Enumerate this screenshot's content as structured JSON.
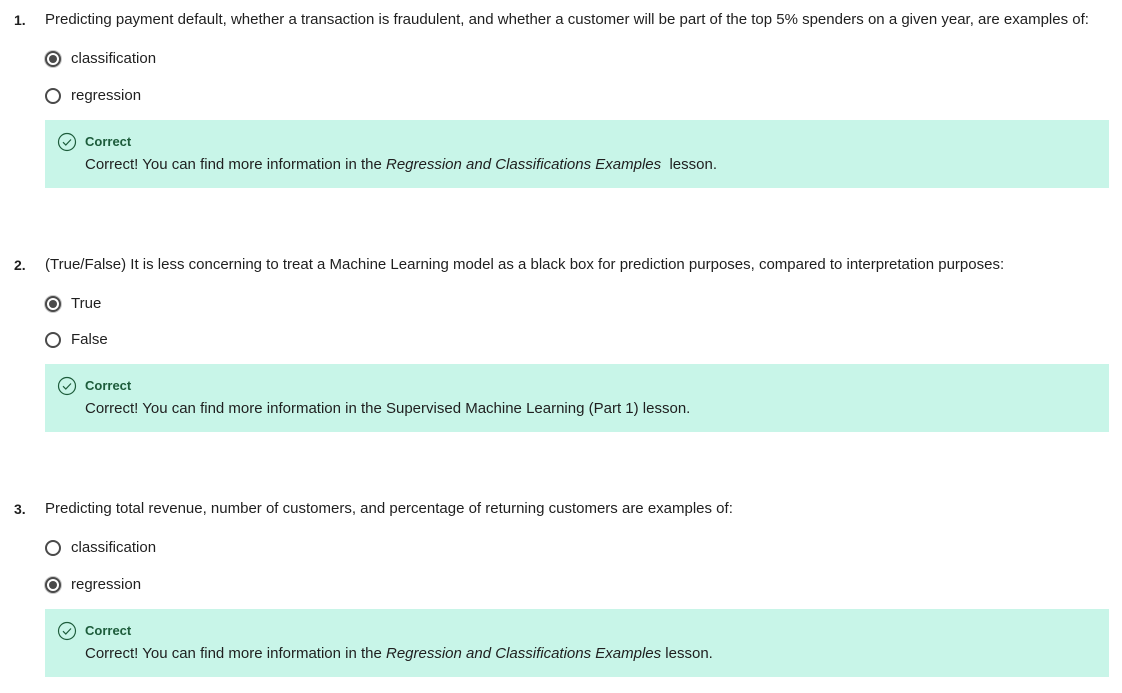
{
  "colors": {
    "feedback_bg": "#c8f5e8",
    "feedback_title": "#1d5c3b",
    "radio": "#4a4a4a"
  },
  "questions": [
    {
      "number": "1.",
      "text": "Predicting payment default, whether a transaction is fraudulent, and whether a customer will be part of the top 5% spenders on a given year, are examples of:",
      "options": [
        {
          "label": "classification",
          "selected": true
        },
        {
          "label": "regression",
          "selected": false
        }
      ],
      "feedback": {
        "icon": "check-circle-icon",
        "title": "Correct",
        "message_prefix": "Correct! You can find more information in the ",
        "lesson": "Regression and Classifications Examples",
        "message_suffix": "  lesson."
      }
    },
    {
      "number": "2.",
      "text": "(True/False) It is less concerning to treat a Machine Learning model as a black box for prediction purposes, compared to interpretation purposes:",
      "options": [
        {
          "label": "True",
          "selected": true
        },
        {
          "label": "False",
          "selected": false
        }
      ],
      "feedback": {
        "icon": "check-circle-icon",
        "title": "Correct",
        "message": "Correct! You can find more information in the Supervised Machine Learning (Part 1) lesson."
      }
    },
    {
      "number": "3.",
      "text": "Predicting total revenue, number of customers, and percentage of returning customers are examples of:",
      "options": [
        {
          "label": "classification",
          "selected": false
        },
        {
          "label": "regression",
          "selected": true
        }
      ],
      "feedback": {
        "icon": "check-circle-icon",
        "title": "Correct",
        "message_prefix": "Correct! You can find more information in the ",
        "lesson": "Regression and Classifications Examples",
        "message_suffix": " lesson."
      }
    }
  ]
}
